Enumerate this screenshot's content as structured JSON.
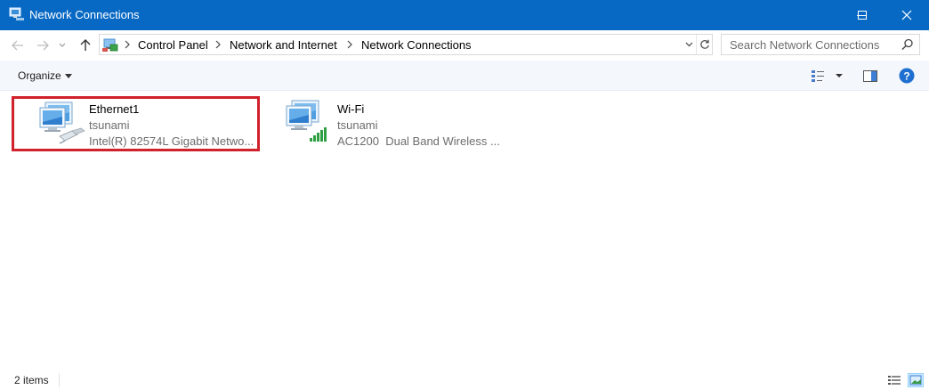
{
  "window": {
    "title": "Network Connections",
    "accent": "#0869c4",
    "controls": {
      "minimize": "minimize-icon",
      "maximize": "maximize-icon",
      "close": "close-icon"
    }
  },
  "address": {
    "breadcrumbs": [
      "Control Panel",
      "Network and Internet",
      "Network Connections"
    ]
  },
  "search": {
    "placeholder": "Search Network Connections"
  },
  "toolbar": {
    "organize_label": "Organize"
  },
  "connections": [
    {
      "name": "Ethernet1",
      "network": "tsunami",
      "device": "Intel(R) 82574L Gigabit Netwo...",
      "icon": "ethernet-adapter-icon",
      "highlighted": true,
      "highlight_color": "#d0212c"
    },
    {
      "name": "Wi-Fi",
      "network": "tsunami",
      "device": "AC1200  Dual Band Wireless ...",
      "icon": "wifi-adapter-icon",
      "highlighted": false
    }
  ],
  "status": {
    "item_count": "2 items"
  }
}
